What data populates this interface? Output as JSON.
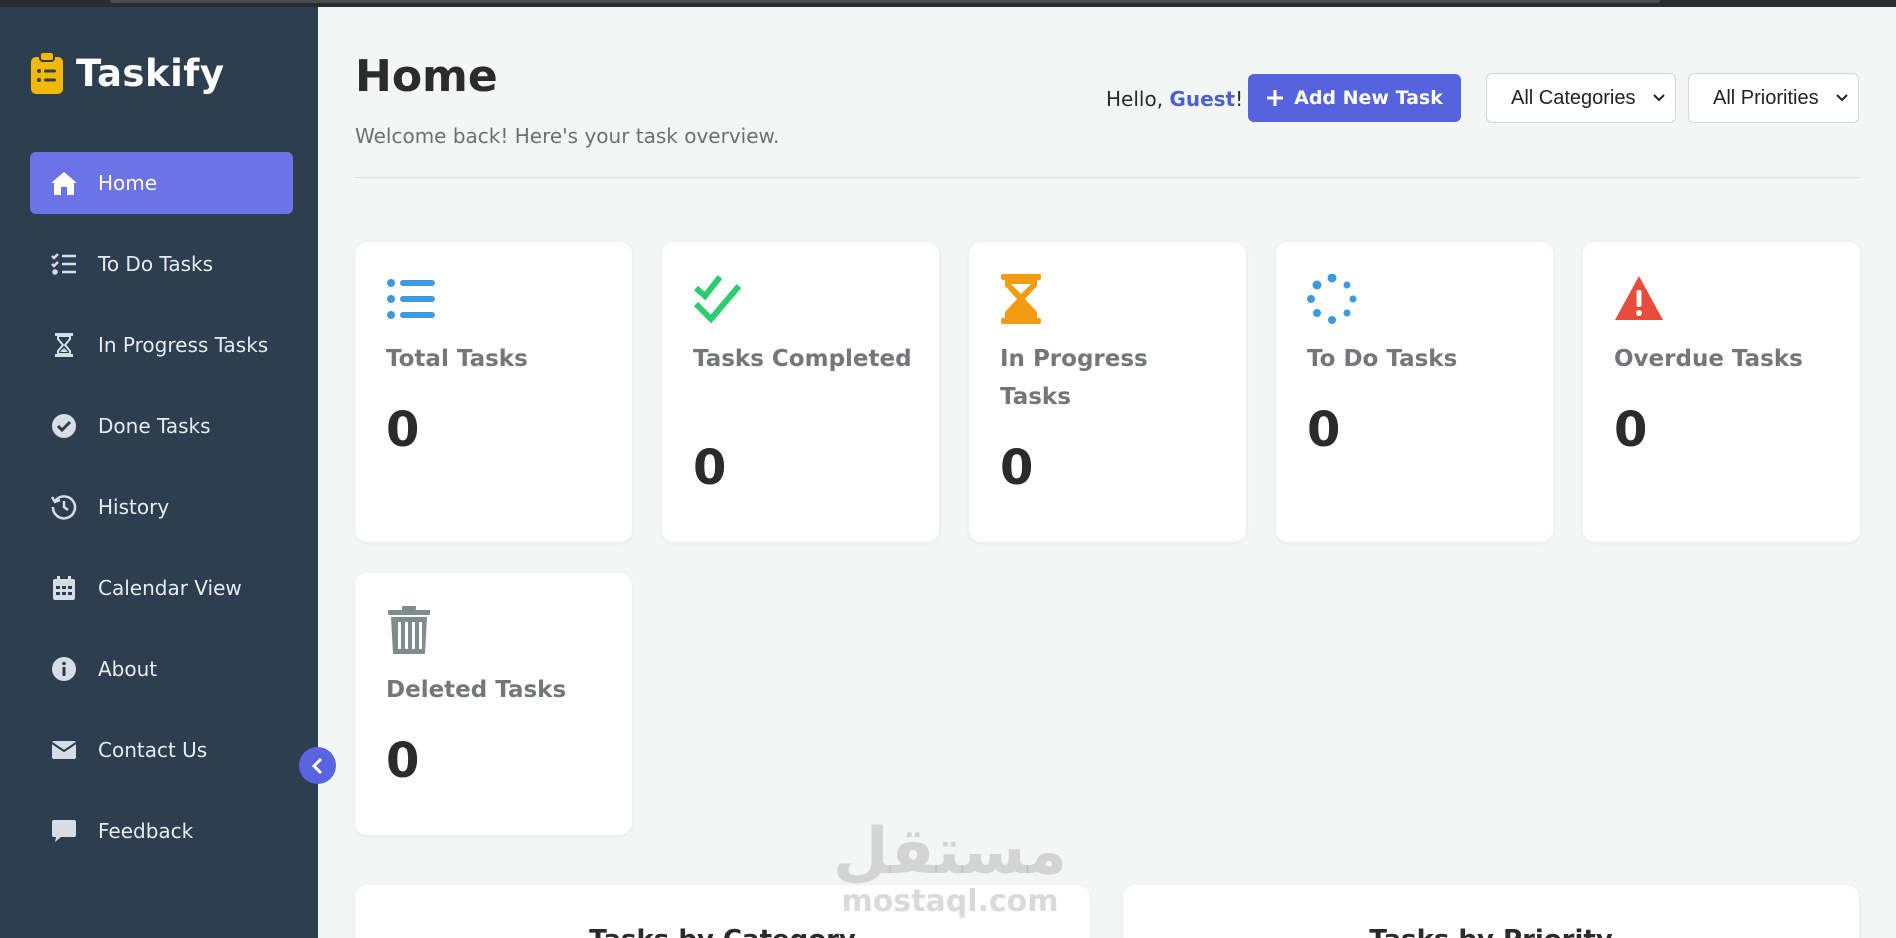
{
  "app": {
    "name": "Taskify"
  },
  "sidebar": {
    "items": [
      {
        "label": "Home",
        "icon": "home-icon",
        "active": true
      },
      {
        "label": "To Do Tasks",
        "icon": "checklist-icon"
      },
      {
        "label": "In Progress Tasks",
        "icon": "hourglass-icon"
      },
      {
        "label": "Done Tasks",
        "icon": "check-circle-icon"
      },
      {
        "label": "History",
        "icon": "history-icon"
      },
      {
        "label": "Calendar View",
        "icon": "calendar-icon"
      },
      {
        "label": "About",
        "icon": "info-icon"
      },
      {
        "label": "Contact Us",
        "icon": "envelope-icon"
      },
      {
        "label": "Feedback",
        "icon": "comment-icon"
      }
    ]
  },
  "header": {
    "title": "Home",
    "subtitle": "Welcome back! Here's your task overview.",
    "greeting_prefix": "Hello, ",
    "user": "Guest",
    "greeting_suffix": "!",
    "add_button": "Add New Task",
    "category_filter": "All Categories",
    "priority_filter": "All Priorities"
  },
  "stats": [
    {
      "label": "Total Tasks",
      "value": "0",
      "icon": "list-icon",
      "color": "#3b9ae1"
    },
    {
      "label": "Tasks Completed",
      "value": "0",
      "icon": "double-check-icon",
      "color": "#2ecc71"
    },
    {
      "label": "In Progress Tasks",
      "value": "0",
      "icon": "hourglass-icon",
      "color": "#f39c12"
    },
    {
      "label": "To Do Tasks",
      "value": "0",
      "icon": "spinner-icon",
      "color": "#3b9ae1"
    },
    {
      "label": "Overdue Tasks",
      "value": "0",
      "icon": "warning-icon",
      "color": "#e74c3c"
    },
    {
      "label": "Deleted Tasks",
      "value": "0",
      "icon": "trash-icon",
      "color": "#7f8c8d"
    }
  ],
  "panels": {
    "category_title": "Tasks by Category",
    "priority_title": "Tasks by Priority"
  },
  "colors": {
    "sidebar": "#2d3e50",
    "accent": "#5563de",
    "brand_icon": "#f5b800"
  },
  "watermark": {
    "arabic": "مستقل",
    "latin": "mostaql.com"
  }
}
